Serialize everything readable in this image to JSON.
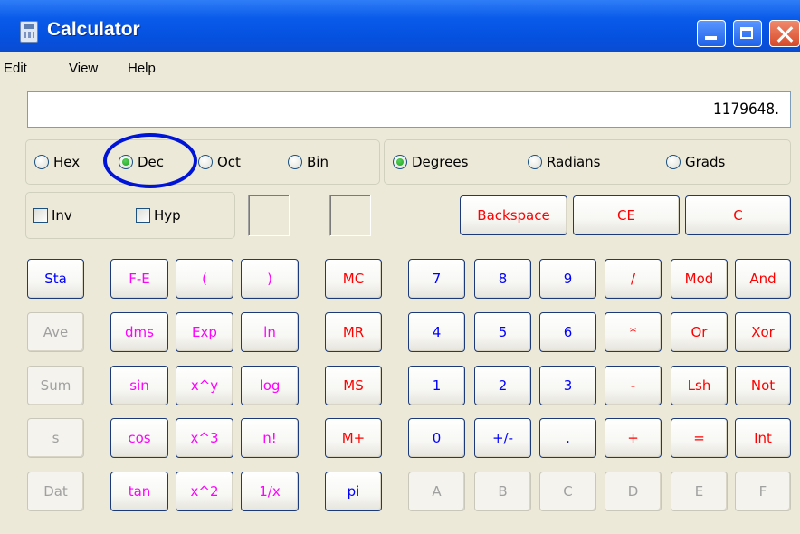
{
  "window": {
    "title": "Calculator"
  },
  "menu": [
    {
      "label": "Edit",
      "name": "menu-edit"
    },
    {
      "label": "View",
      "name": "menu-view"
    },
    {
      "label": "Help",
      "name": "menu-help"
    }
  ],
  "display": {
    "value": "1179648."
  },
  "number_system": {
    "options": [
      "Hex",
      "Dec",
      "Oct",
      "Bin"
    ],
    "selected": "Dec"
  },
  "angle_units": {
    "options": [
      "Degrees",
      "Radians",
      "Grads"
    ],
    "selected": "Degrees"
  },
  "checkboxes": {
    "inv": "Inv",
    "hyp": "Hyp"
  },
  "top_buttons": {
    "backspace": "Backspace",
    "ce": "CE",
    "c": "C"
  },
  "keys": [
    [
      "Sta",
      "F-E",
      "(",
      ")",
      "MC",
      "7",
      "8",
      "9",
      "/",
      "Mod",
      "And"
    ],
    [
      "Ave",
      "dms",
      "Exp",
      "ln",
      "MR",
      "4",
      "5",
      "6",
      "*",
      "Or",
      "Xor"
    ],
    [
      "Sum",
      "sin",
      "x^y",
      "log",
      "MS",
      "1",
      "2",
      "3",
      "-",
      "Lsh",
      "Not"
    ],
    [
      "s",
      "cos",
      "x^3",
      "n!",
      "M+",
      "0",
      "+/-",
      ".",
      "+",
      "=",
      "Int"
    ],
    [
      "Dat",
      "tan",
      "x^2",
      "1/x",
      "pi",
      "A",
      "B",
      "C",
      "D",
      "E",
      "F"
    ]
  ],
  "colors": {
    "title_bar": "#0a5bea",
    "digits": "#0000ff",
    "operators": "#ff0000",
    "functions": "#ff00ff",
    "disabled": "#a0a0a0",
    "annotation_circle": "#0014d8"
  }
}
